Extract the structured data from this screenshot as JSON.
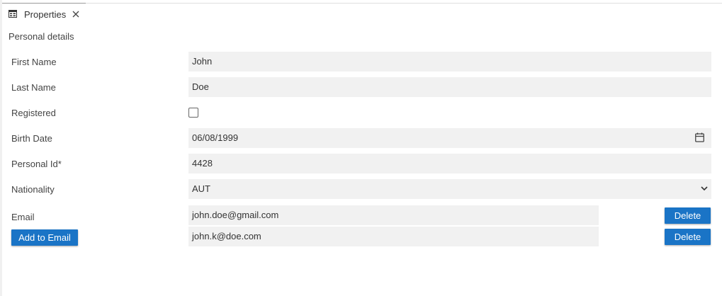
{
  "tab": {
    "title": "Properties",
    "icon": "table-icon",
    "close_icon": "close-icon"
  },
  "section": {
    "title": "Personal details"
  },
  "form": {
    "first_name": {
      "label": "First Name",
      "value": "John"
    },
    "last_name": {
      "label": "Last Name",
      "value": "Doe"
    },
    "registered": {
      "label": "Registered",
      "checked": false
    },
    "birth_date": {
      "label": "Birth Date",
      "value": "06/08/1999",
      "icon": "calendar-icon"
    },
    "personal_id": {
      "label": "Personal Id*",
      "value": "4428"
    },
    "nationality": {
      "label": "Nationality",
      "value": "AUT",
      "icon": "chevron-down-icon"
    },
    "email": {
      "label": "Email",
      "add_button": "Add to Email",
      "items": [
        {
          "value": "john.doe@gmail.com",
          "delete_label": "Delete"
        },
        {
          "value": "john.k@doe.com",
          "delete_label": "Delete"
        }
      ]
    }
  },
  "colors": {
    "accent": "#1a74c6",
    "field_bg": "#f1f1f1"
  }
}
